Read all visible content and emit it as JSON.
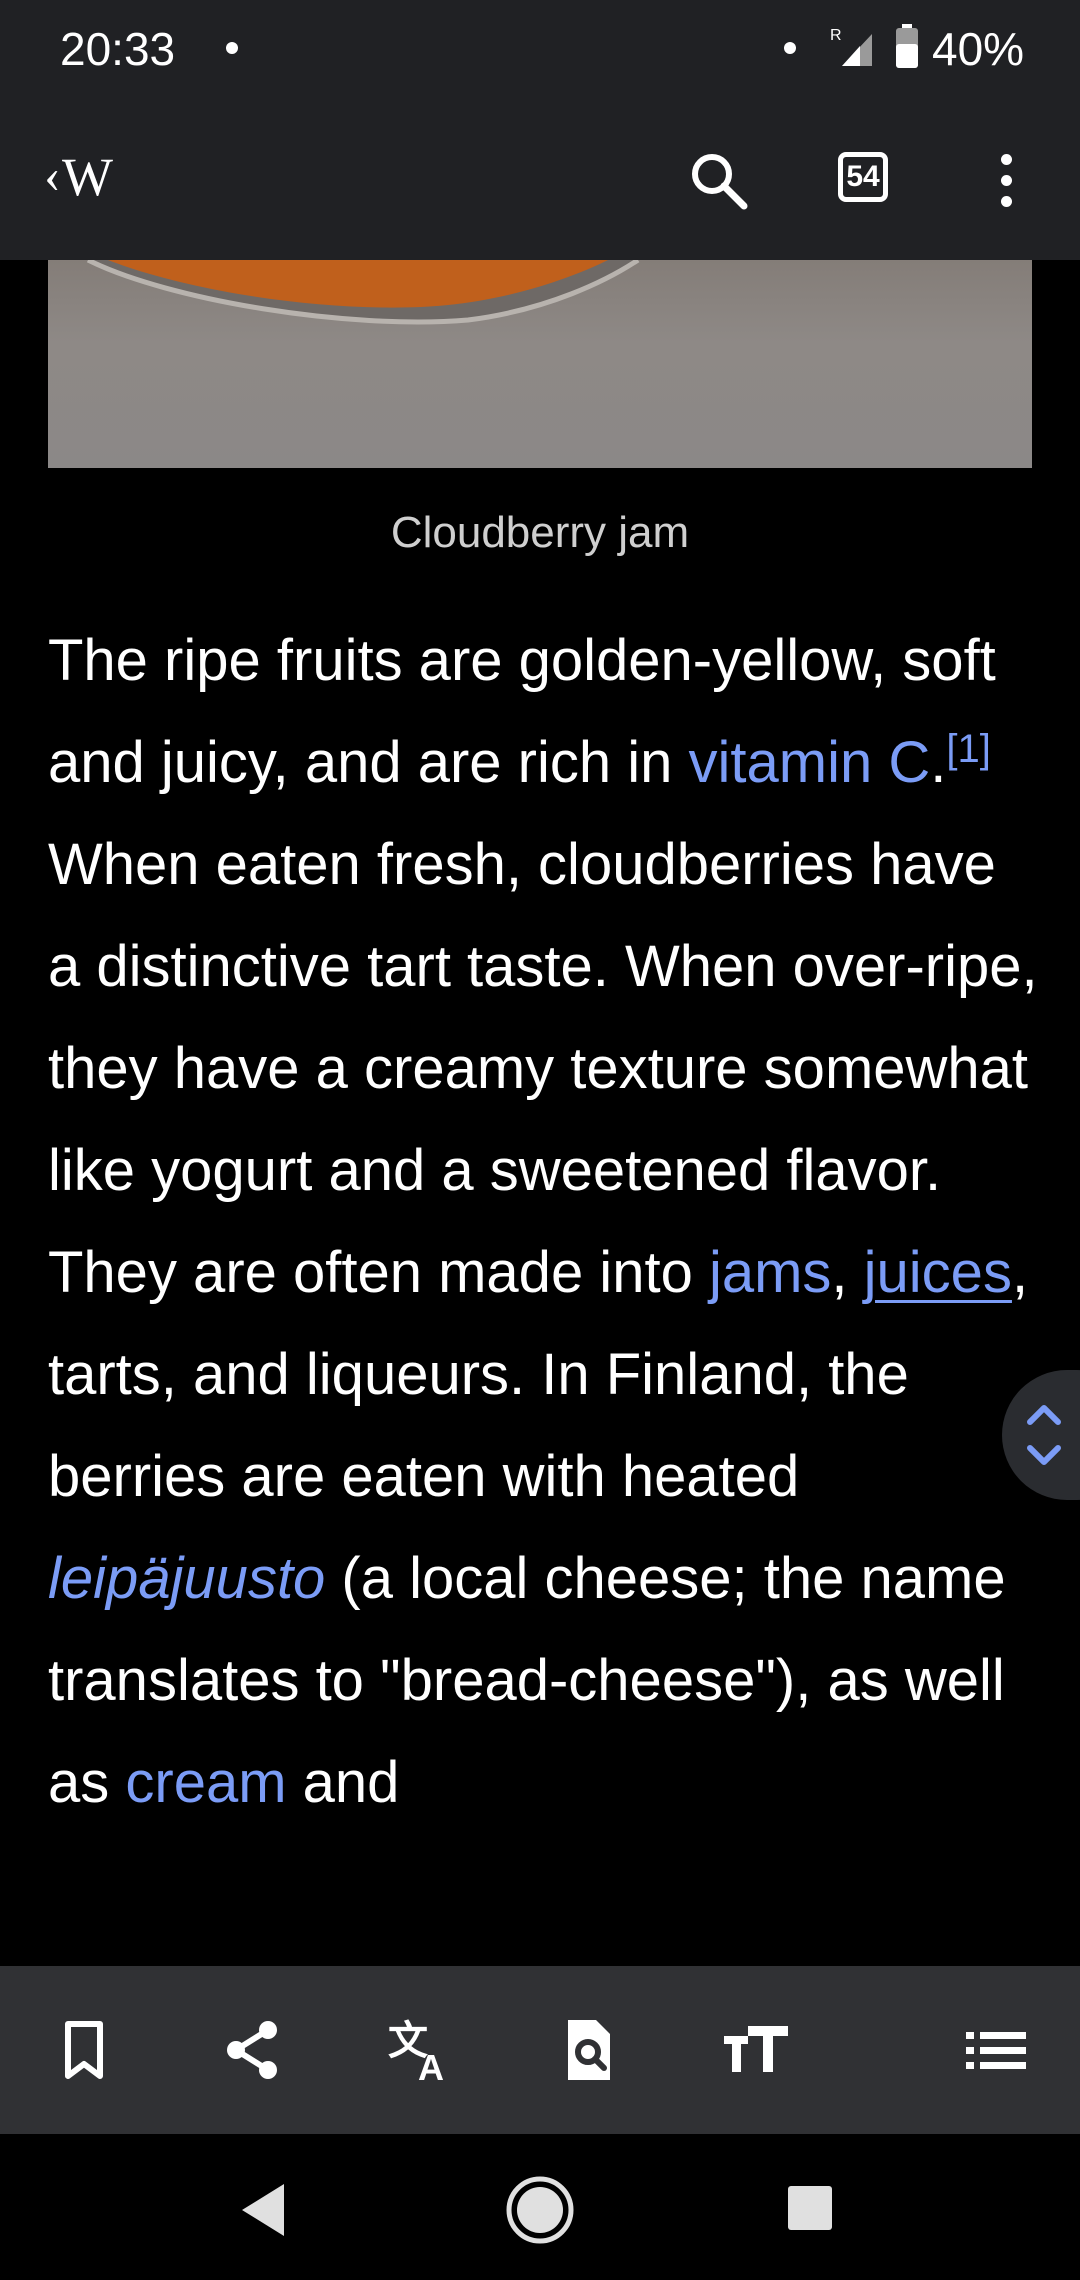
{
  "status_bar": {
    "time": "20:33",
    "roaming_indicator": "R",
    "battery": "40%"
  },
  "app_bar": {
    "logo_text": "W",
    "logo_chevron": "‹",
    "tabs_count": "54"
  },
  "article": {
    "image_caption": "Cloudberry jam",
    "paragraph": {
      "t1": "The ripe fruits are golden-yellow, soft and juicy, and are rich in ",
      "link_vitamin": "vitamin C",
      "t2": ".",
      "ref1": "[1]",
      "t3": " When eaten fresh, cloudberries have a distinctive tart taste. When over-ripe, they have a creamy texture somewhat like yogurt and a sweetened flavor. They are often made into ",
      "link_jams": "jams",
      "t4": ", ",
      "link_juices": "juices",
      "t5": ", tarts, and liqueurs. In Finland, the berries are eaten with heated ",
      "link_leipajuusto": "leipäjuusto",
      "t6": " (a local cheese; the name translates to \"bread-cheese\"), as well as ",
      "link_cream": "cream",
      "t7": " and"
    }
  },
  "toolbar": {
    "icons": [
      "bookmark-icon",
      "share-icon",
      "translate-icon",
      "find-in-page-icon",
      "text-size-icon",
      "contents-icon"
    ]
  },
  "colors": {
    "bar_background": "#202124",
    "toolbar_background": "#303134",
    "link": "#7b9cf6",
    "content_background": "#000000"
  }
}
